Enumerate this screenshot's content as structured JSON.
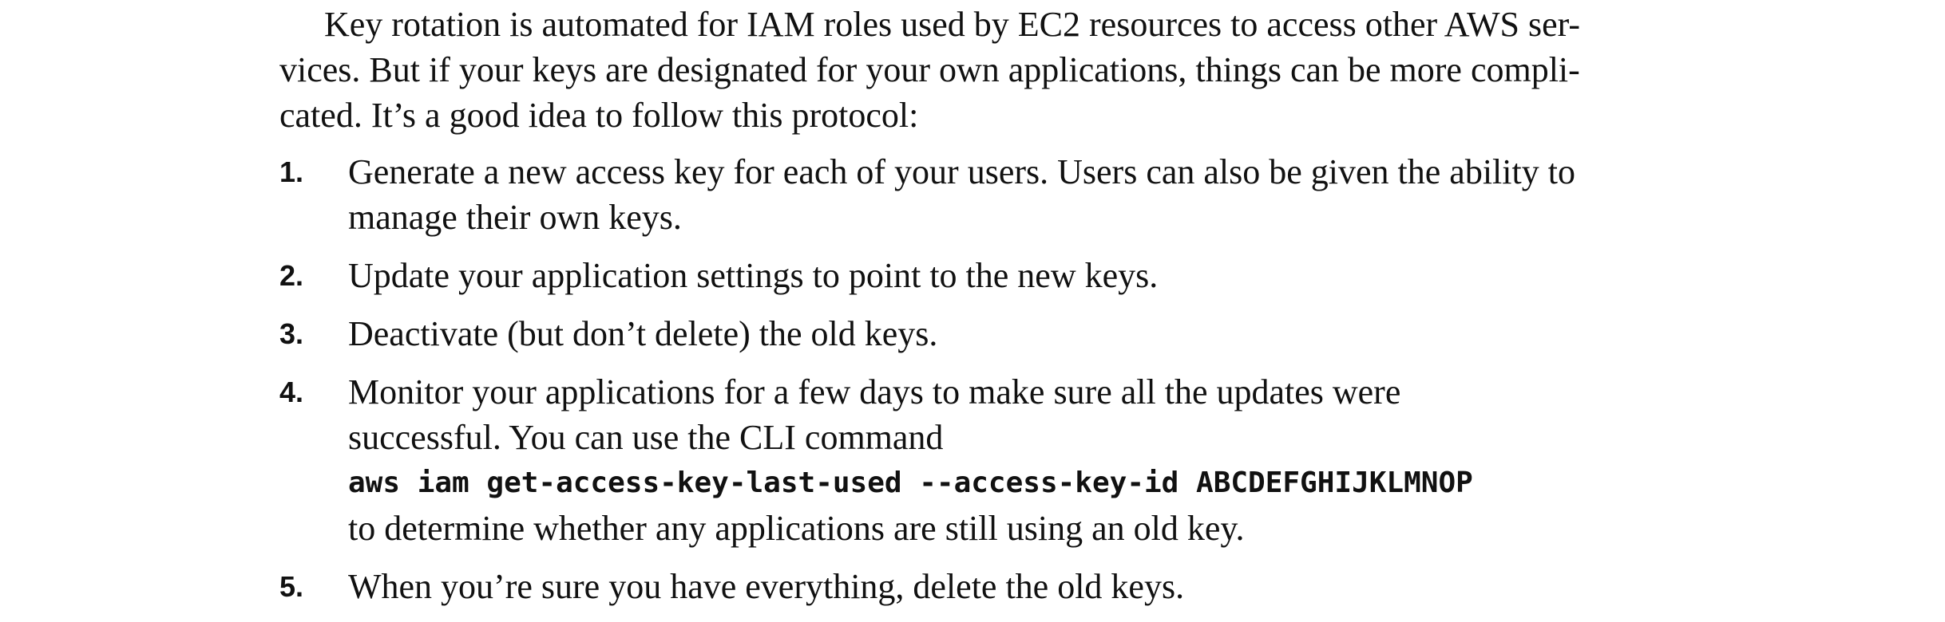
{
  "intro": {
    "lines": [
      "Key rotation is automated for IAM roles used by EC2 resources to access other AWS ser-",
      "vices. But if your keys are designated for your own applications, things can be more compli-",
      "cated. It’s a good idea to follow this protocol:"
    ]
  },
  "steps": [
    {
      "number": "1.",
      "lines": [
        "Generate a new access key for each of your users. Users can also be given the ability to",
        "manage their own keys."
      ]
    },
    {
      "number": "2.",
      "lines": [
        "Update your application settings to point to the new keys."
      ]
    },
    {
      "number": "3.",
      "lines": [
        "Deactivate (but don’t delete) the old keys."
      ]
    },
    {
      "number": "4.",
      "lines": [
        "Monitor your applications for a few days to make sure all the updates were",
        "successful. You can use the CLI command"
      ],
      "code": "aws iam get-access-key-last-used --access-key-id ABCDEFGHIJKLMNOP",
      "after": "to determine whether any applications are still using an old key."
    },
    {
      "number": "5.",
      "lines": [
        "When you’re sure you have everything, delete the old keys."
      ]
    }
  ]
}
